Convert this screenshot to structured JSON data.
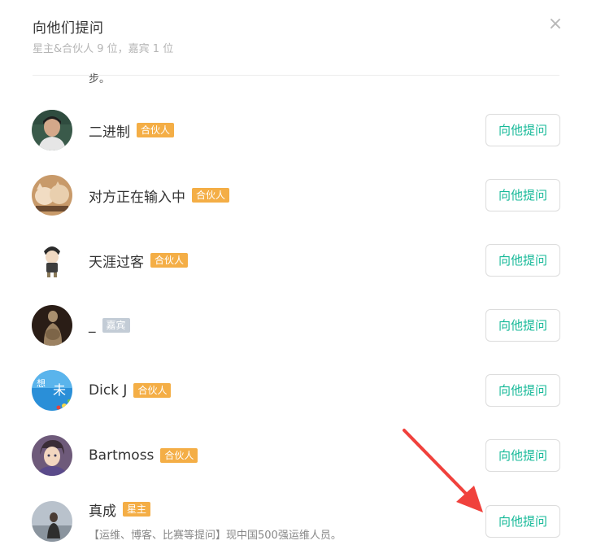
{
  "dialog": {
    "title": "向他们提问",
    "subtitle": "星主&合伙人 9 位，嘉宾 1 位",
    "close_symbol": "×",
    "clipped_text": "步。"
  },
  "members": [
    {
      "name": "二进制",
      "badge": "合伙人",
      "badge_type": "partner",
      "button": "向他提问",
      "avatar_icon": "portrait-icon"
    },
    {
      "name": "对方正在输入中",
      "badge": "合伙人",
      "badge_type": "partner",
      "button": "向他提问",
      "avatar_icon": "cat-avatar-icon"
    },
    {
      "name": "天涯过客",
      "badge": "合伙人",
      "badge_type": "partner",
      "button": "向他提问",
      "avatar_icon": "cartoon-avatar-icon"
    },
    {
      "name": "_",
      "badge": "嘉宾",
      "badge_type": "guest",
      "button": "向他提问",
      "avatar_icon": "statue-avatar-icon"
    },
    {
      "name": "Dick J",
      "badge": "合伙人",
      "badge_type": "partner",
      "button": "向他提问",
      "avatar_icon": "blue-art-avatar-icon"
    },
    {
      "name": "Bartmoss",
      "badge": "合伙人",
      "badge_type": "partner",
      "button": "向他提问",
      "avatar_icon": "anime-avatar-icon"
    },
    {
      "name": "真成",
      "badge": "星主",
      "badge_type": "owner",
      "button": "向他提问",
      "avatar_icon": "photo-avatar-icon",
      "description": "【运维、博客、比赛等提问】现中国500强运维人员。"
    }
  ],
  "colors": {
    "accent": "#16b998",
    "partner_badge": "#f4ae46",
    "guest_badge": "#c3ccd6",
    "arrow": "#f0413c"
  }
}
